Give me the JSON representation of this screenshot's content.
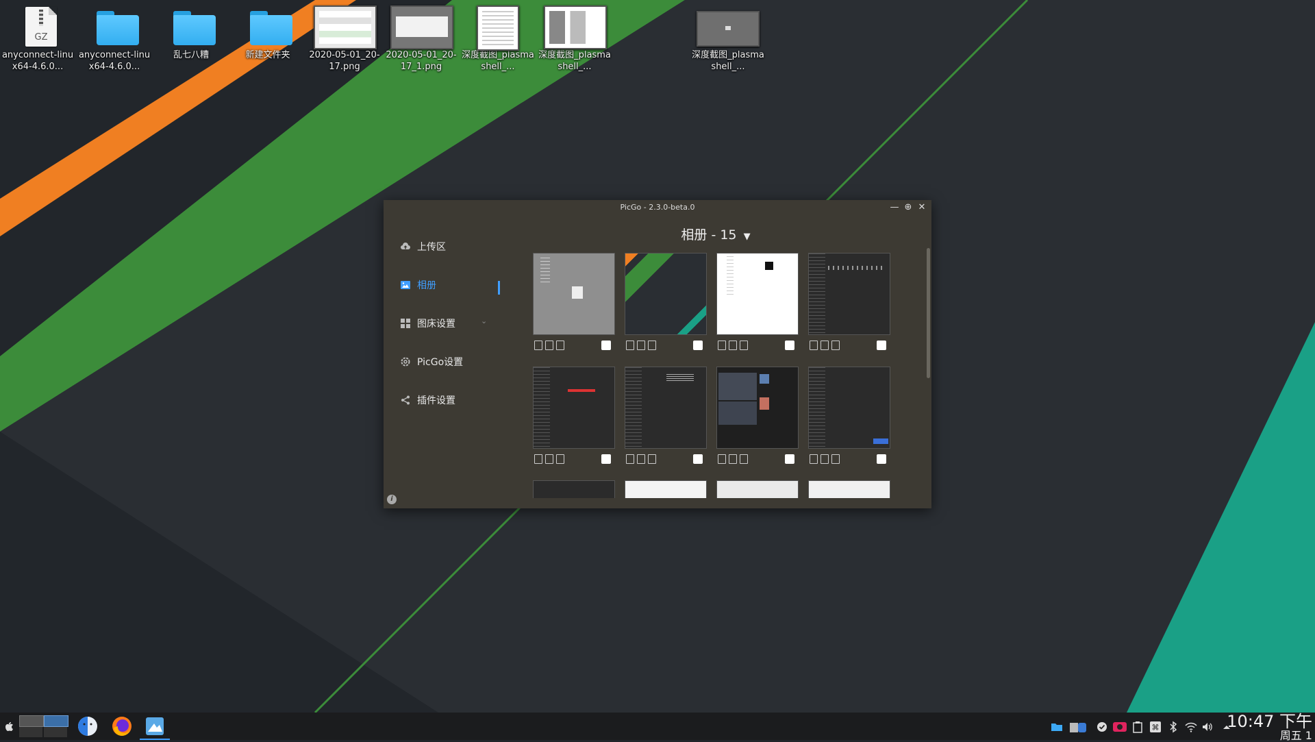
{
  "desktop": {
    "icons": [
      {
        "label": "anyconnect-linux64-4.6.0...",
        "type": "archive",
        "badge": "GZ"
      },
      {
        "label": "anyconnect-linux64-4.6.0...",
        "type": "folder"
      },
      {
        "label": "乱七八糟",
        "type": "folder"
      },
      {
        "label": "新建文件夹",
        "type": "folder"
      },
      {
        "label": "2020-05-01_20-17.png",
        "type": "image"
      },
      {
        "label": "2020-05-01_20-17_1.png",
        "type": "image"
      },
      {
        "label": "深度截图_plasmashell_...",
        "type": "image"
      },
      {
        "label": "深度截图_plasmashell_...",
        "type": "image"
      },
      {
        "label": "深度截图_plasmashell_...",
        "type": "image"
      }
    ],
    "colors": {
      "background": "#22262b",
      "orange": "#f07f22",
      "green": "#3c8c3a",
      "teal": "#1aa086"
    }
  },
  "window": {
    "title": "PicGo - 2.3.0-beta.0",
    "controls": [
      "minimize-icon",
      "maximize-icon",
      "close-icon"
    ],
    "sidebar": {
      "items": [
        {
          "label": "上传区",
          "icon": "cloud-upload-icon"
        },
        {
          "label": "相册",
          "icon": "picture-icon",
          "active": true
        },
        {
          "label": "图床设置",
          "icon": "grid-icon",
          "expandable": true
        },
        {
          "label": "PicGo设置",
          "icon": "gear-icon"
        },
        {
          "label": "插件设置",
          "icon": "share-icon"
        }
      ]
    },
    "gallery": {
      "title": "相册 - 15",
      "accent": "#409eff",
      "item_tools": [
        "copy-icon",
        "edit-icon",
        "delete-icon"
      ]
    },
    "info_icon": "i"
  },
  "taskbar": {
    "apps": [
      "launcher-icon",
      "workspace-pager",
      "finder-icon",
      "firefox-icon",
      "picgo-icon"
    ],
    "tray": [
      "folder-icon",
      "trash-icon",
      "check-icon",
      "record-icon",
      "clipboard-icon",
      "command-icon",
      "bluetooth-icon",
      "wifi-icon",
      "volume-icon",
      "arrow-up-icon"
    ],
    "clock": {
      "time": "10:47 下午",
      "day": "周五 1"
    }
  }
}
